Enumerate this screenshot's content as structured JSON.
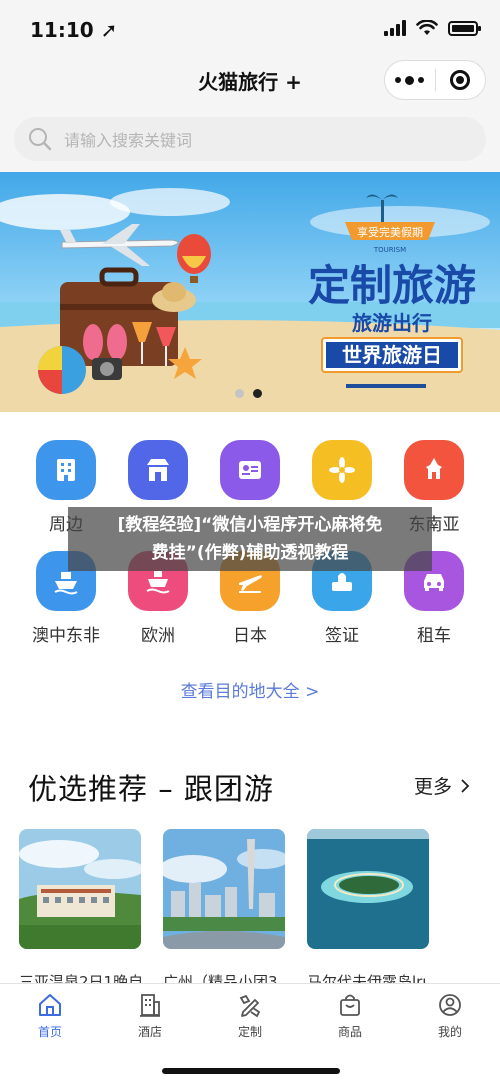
{
  "status_bar": {
    "time": "11:10 ➚"
  },
  "nav": {
    "title": "火猫旅行 +"
  },
  "search": {
    "placeholder": "请输入搜索关键词"
  },
  "banner": {
    "badge_main": "享受完美假期",
    "badge_sub": "TOURISM",
    "headline": "定制旅游",
    "subheadline": "旅游出行",
    "slogan": "世界旅游日",
    "slides_count": 2,
    "active_slide": 2
  },
  "categories": [
    {
      "label": "周边",
      "color": "#3d95ec",
      "icon": "building-icon"
    },
    {
      "label": "",
      "color": "#5266e8",
      "icon": "store-icon"
    },
    {
      "label": "",
      "color": "#8c5ae8",
      "icon": "id-card-icon"
    },
    {
      "label": "",
      "color": "#f5be22",
      "icon": "flower-icon"
    },
    {
      "label": "东南亚",
      "color": "#f2543e",
      "icon": "temple-icon"
    },
    {
      "label": "澳中东非",
      "color": "#3d95ec",
      "icon": "ship-icon"
    },
    {
      "label": "欧洲",
      "color": "#ee4c7c",
      "icon": "cruise-icon"
    },
    {
      "label": "日本",
      "color": "#f5a12c",
      "icon": "plane-icon"
    },
    {
      "label": "签证",
      "color": "#3aa5e8",
      "icon": "visa-icon"
    },
    {
      "label": "租车",
      "color": "#a856e0",
      "icon": "car-icon"
    }
  ],
  "watermark": {
    "line1": "[教程经验]“微信小程序开心麻将免",
    "line2": "费挂”(作弊)辅助透视教程"
  },
  "see_all": "查看目的地大全 >",
  "section": {
    "title": "优选推荐 – 跟团游",
    "more": "更多"
  },
  "cards": [
    {
      "caption": "三亚温泉2日1晚自"
    },
    {
      "caption": "广州（精品小团3"
    },
    {
      "caption": "马尔代夫伊露岛lru"
    }
  ],
  "tabs": [
    {
      "label": "首页",
      "icon": "home-icon",
      "active": true
    },
    {
      "label": "酒店",
      "icon": "hotel-icon",
      "active": false
    },
    {
      "label": "定制",
      "icon": "customize-icon",
      "active": false
    },
    {
      "label": "商品",
      "icon": "shopping-bag-icon",
      "active": false
    },
    {
      "label": "我的",
      "icon": "profile-icon",
      "active": false
    }
  ],
  "colors": {
    "accent": "#3b6ce0",
    "link": "#5a7bd8",
    "background": "#f5f5f5"
  }
}
